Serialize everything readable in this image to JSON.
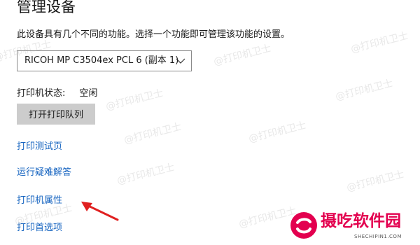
{
  "page": {
    "title": "管理设备",
    "description": "此设备具有几个不同的功能。选择一个功能即可管理该功能的设置。"
  },
  "printer_select": {
    "value": "RICOH MP C3504ex PCL 6 (副本 1)"
  },
  "status": {
    "label": "打印机状态:",
    "value": "空闲"
  },
  "actions": {
    "open_queue": "打开打印队列"
  },
  "links": [
    {
      "label": "打印测试页"
    },
    {
      "label": "运行疑难解答"
    },
    {
      "label": "打印机属性"
    },
    {
      "label": "打印首选项"
    }
  ],
  "watermark": {
    "text": "@打印机卫士"
  },
  "brand": {
    "name": "摄吃软件园",
    "url": "SHECHIPIN1.COM",
    "color": "#e3004f"
  },
  "colors": {
    "link": "#1664c0",
    "button_bg": "#cccccc",
    "arrow": "#e02020"
  }
}
